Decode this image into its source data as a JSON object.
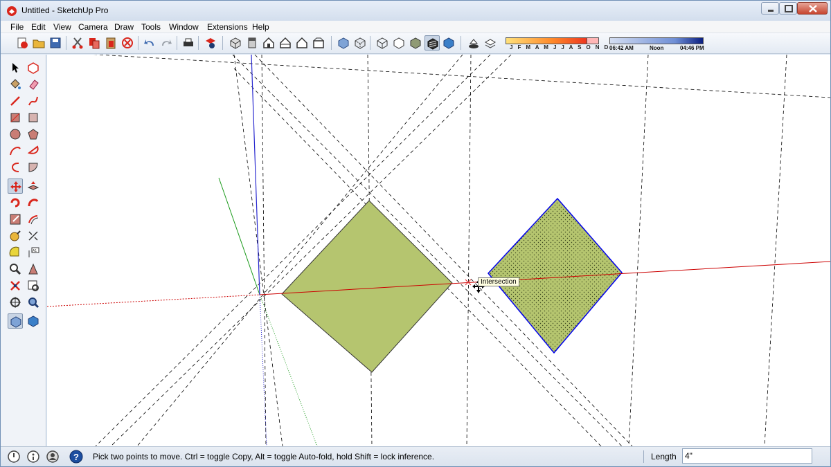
{
  "window": {
    "title": "Untitled - SketchUp Pro",
    "app_icon": "sketchup-logo-icon",
    "controls": [
      "minimize-icon",
      "maximize-icon",
      "close-icon"
    ]
  },
  "menu": {
    "items": [
      "File",
      "Edit",
      "View",
      "Camera",
      "Draw",
      "Tools",
      "Window",
      "Extensions",
      "Help"
    ]
  },
  "toolbar": {
    "icons": [
      "new-icon",
      "open-icon",
      "save-icon",
      "cut-icon",
      "copy-icon",
      "paste-icon",
      "erase-icon",
      "undo-icon",
      "redo-icon",
      "print-icon",
      "model-info-icon",
      "iso-view-icon",
      "top-view-icon",
      "front-view-icon",
      "right-view-icon",
      "back-view-icon",
      "left-view-icon",
      "xray-icon",
      "back-edges-icon",
      "wireframe-icon",
      "hidden-line-icon",
      "shaded-icon",
      "shaded-textures-icon",
      "monochrome-icon",
      "shadows-icon",
      "fog-icon"
    ],
    "active_style": "shaded-textures-icon",
    "shadow": {
      "months": "J F M A M J J A S O N D",
      "time_start": "06:42 AM",
      "time_mid": "Noon",
      "time_end": "04:46 PM"
    }
  },
  "palette": {
    "tools": [
      "select-icon",
      "make-component-icon",
      "paint-bucket-icon",
      "eraser-icon",
      "line-icon",
      "freehand-icon",
      "rectangle-icon",
      "rotated-rectangle-icon",
      "circle-icon",
      "polygon-icon",
      "arc-icon",
      "pie-icon",
      "two-point-arc-icon",
      "three-point-arc-icon",
      "move-icon",
      "push-pull-icon",
      "rotate-icon",
      "follow-me-icon",
      "scale-icon",
      "offset-icon",
      "tape-measure-icon",
      "dimension-icon",
      "protractor-icon",
      "text-icon",
      "axes-icon",
      "3d-text-icon",
      "orbit-icon",
      "pan-icon",
      "zoom-icon",
      "zoom-window-icon",
      "zoom-extents-icon",
      "position-camera-icon",
      "walk-icon",
      "look-around-icon"
    ],
    "active_tool": "move-icon"
  },
  "viewport": {
    "tooltip": "Intersection",
    "colors": {
      "face_fill": "#b5c56f",
      "red_axis": "#cc0000",
      "green_axis": "#1a9a1a",
      "blue_axis": "#2a2ad0",
      "selection": "#0000ee"
    }
  },
  "status": {
    "icons": [
      "geo-location-icon",
      "credits-icon",
      "user-icon",
      "help-icon"
    ],
    "message": "Pick two points to move.  Ctrl = toggle Copy, Alt = toggle Auto-fold, hold Shift = lock inference.",
    "vcb_label": "Length",
    "vcb_value": "4\""
  }
}
